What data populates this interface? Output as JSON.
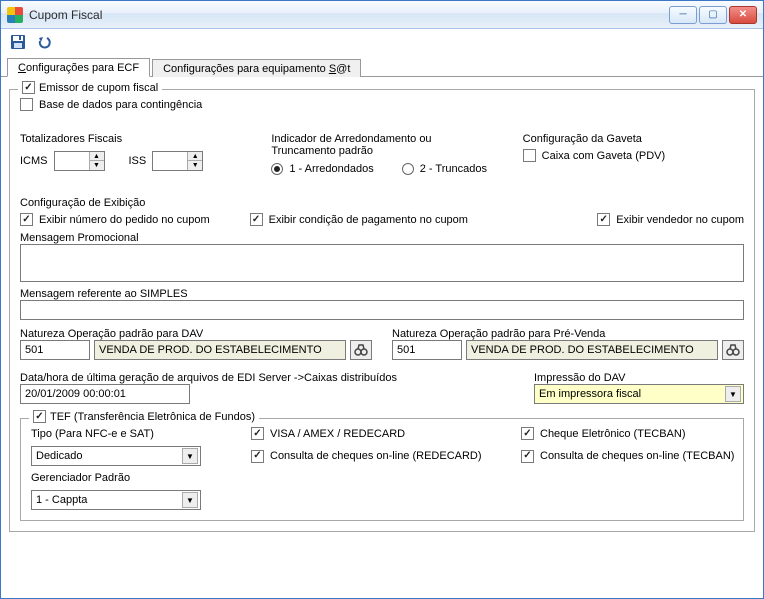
{
  "window": {
    "title": "Cupom Fiscal"
  },
  "tabs": {
    "ecf": {
      "prefix": "C",
      "rest": "onfigurações para ECF"
    },
    "sat": {
      "prefix": "Configurações para equipamento ",
      "und": "S",
      "suffix": "@t"
    }
  },
  "emissor": {
    "legend": "Emissor de cupom fiscal",
    "base_contingencia": "Base de dados para contingência",
    "totalizadores_hdr": "Totalizadores Fiscais",
    "icms_label": "ICMS",
    "icms_value": "",
    "iss_label": "ISS",
    "iss_value": "",
    "indicador_hdr": "Indicador de Arredondamento ou Truncamento padrão",
    "radio1": "1 - Arredondados",
    "radio2": "2 - Truncados",
    "gaveta_hdr": "Configuração da Gaveta",
    "gaveta_chk": "Caixa com Gaveta (PDV)",
    "exib_hdr": "Configuração de Exibição",
    "exib_pedido": "Exibir número do pedido no cupom",
    "exib_cond": "Exibir condição de pagamento no cupom",
    "exib_vend": "Exibir vendedor no cupom",
    "msg_promo_label": "Mensagem Promocional",
    "msg_promo_value": "",
    "msg_simples_label": "Mensagem referente ao SIMPLES",
    "msg_simples_value": "",
    "nat_dav_label": "Natureza Operação padrão para DAV",
    "nat_dav_code": "501",
    "nat_dav_desc": "VENDA DE PROD. DO ESTABELECIMENTO",
    "nat_pre_label": "Natureza Operação padrão para Pré-Venda",
    "nat_pre_code": "501",
    "nat_pre_desc": "VENDA DE PROD. DO ESTABELECIMENTO",
    "edi_label": "Data/hora de última geração de arquivos de EDI Server ->Caixas distribuídos",
    "edi_value": "20/01/2009 00:00:01",
    "impr_dav_label": "Impressão do DAV",
    "impr_dav_value": "Em impressora fiscal"
  },
  "tef": {
    "legend": "TEF (Transferência Eletrônica de Fundos)",
    "tipo_label": "Tipo (Para NFC-e e SAT)",
    "tipo_value": "Dedicado",
    "gerenc_label": "Gerenciador Padrão",
    "gerenc_value": "1 - Cappta",
    "visa": "VISA / AMEX / REDECARD",
    "consulta_rede": "Consulta de cheques on-line (REDECARD)",
    "cheque_tecban": "Cheque Eletrônico (TECBAN)",
    "consulta_tecban": "Consulta de cheques on-line (TECBAN)"
  }
}
